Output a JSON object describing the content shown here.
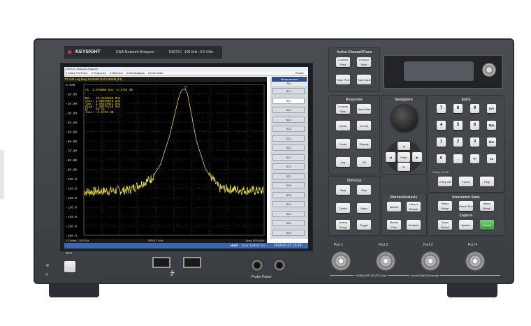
{
  "header": {
    "brand": "KEYSIGHT",
    "model": "ENA Network Analyzer",
    "model_no": "E5071C",
    "freq_range": "100 kHz - 8.5 GHz"
  },
  "screen": {
    "title": "E5071C Network Analyzer",
    "menu": [
      "1 Active Ch/Trace",
      "2 Response",
      "3 Stimulus",
      "4 Mkr/Analysis",
      "5 Instr State"
    ],
    "menu_right": "Resize",
    "trace_label": "Tr1 S21 Log Mag 10.00dB/ Ref 0.000dB [F1]",
    "marker_line": ">1  1.075000 GHz -5.1793 dB",
    "marker_table": [
      {
        "k": "BW:",
        "v": "33.1810200 MHz"
      },
      {
        "k": "cent:",
        "v": "1.06816070 GHz"
      },
      {
        "k": "low:",
        "v": "1.05157021 GHz"
      },
      {
        "k": "high:",
        "v": "1.08475118 GHz"
      },
      {
        "k": "Q:",
        "v": "32.19 ..."
      },
      {
        "k": "loss:",
        "v": "-5.1793 dB"
      }
    ],
    "y_ticks": [
      "0.000",
      "-10.00",
      "-20.00",
      "-30.00",
      "-40.00",
      "-50.00",
      "-60.00",
      "-70.00",
      "-80.00",
      "-90.00",
      "-100.0",
      "-110.0",
      "-120.0",
      "-130.0",
      "-140.0",
      "-150.0",
      "-160.0"
    ],
    "bottom_left": "1  Center 1.05 GHz",
    "bottom_mid": "IFBW 3 kHz",
    "bottom_right": "Span 400 MHz",
    "status_hold": "Hold",
    "status_extref": "Stop: ExtRef Svc",
    "status_date": "2018-07-27 15:29",
    "softkey_title": "Measurement",
    "softkeys": [
      "S11",
      "S21",
      "S31",
      "S41",
      "S12",
      "S22",
      "S32",
      "S42",
      "S13",
      "S23",
      "S33",
      "S43",
      "S14",
      "S24",
      "S34",
      "S44"
    ],
    "softkey_top": "S21"
  },
  "chart_data": {
    "type": "line",
    "title": "",
    "xlabel": "",
    "ylabel": "",
    "ylim": [
      -160,
      0
    ],
    "x_start_ghz": 0.85,
    "x_stop_ghz": 1.25,
    "series": [
      {
        "name": "",
        "x": [
          0.85,
          0.9,
          0.95,
          1.0,
          1.02,
          1.04,
          1.05,
          1.06,
          1.065,
          1.07,
          1.075,
          1.08,
          1.09,
          1.1,
          1.12,
          1.15,
          1.2,
          1.25
        ],
        "values": [
          -114,
          -113,
          -112,
          -100,
          -85,
          -55,
          -35,
          -15,
          -8,
          -5,
          -5.2,
          -10,
          -35,
          -60,
          -90,
          -110,
          -112,
          -113
        ]
      }
    ]
  },
  "front_panel": {
    "active_channel": {
      "title": "Active Channel/Trace",
      "buttons": [
        "Channel Prev",
        "Channel Next",
        "Trace Prev",
        "Trace Next"
      ]
    },
    "response": {
      "title": "Response",
      "buttons": [
        "Channel Max",
        "Trace Max",
        "Meas",
        "Format",
        "Scale",
        "Display",
        "Avg",
        "Cal"
      ]
    },
    "navigation": {
      "title": "Navigation",
      "enter": "Enter"
    },
    "entry": {
      "title": "Entry",
      "keys": [
        "7",
        "8",
        "9",
        "G/n",
        "4",
        "5",
        "6",
        "M/μ",
        "1",
        "2",
        "3",
        "k/m",
        "0",
        ".",
        "+/-",
        "x1"
      ],
      "labels": [
        "Entry Off",
        "Focus",
        "Help"
      ],
      "softkey_label": "Softkey On/Off"
    },
    "stimulus": {
      "title": "Stimulus",
      "buttons": [
        "Start",
        "Stop",
        "Center",
        "Span",
        "Sweep Setup",
        "Trigger"
      ]
    },
    "marker_analysis": {
      "title": "Marker/Analysis",
      "buttons": [
        "Marker",
        "Marker Search",
        "Marker Fctn",
        "Analysis"
      ]
    },
    "instrument_state": {
      "title": "Instrument State",
      "buttons": [
        "Macro Setup",
        "Macro Run",
        "Macro Break"
      ],
      "capture_title": "Capture",
      "capture_buttons": [
        "Save/ Recall",
        "System",
        "Preset"
      ]
    },
    "ports": [
      "Port 1",
      "Port 2",
      "Port 3",
      "Port 4"
    ],
    "port_warning": "+26dBm RF 35 VDC Max",
    "port_warning2": "Avoid Static Discharge",
    "probe_power": "Probe Power",
    "power_label": "On 1",
    "usb_symbol": "⭍"
  }
}
